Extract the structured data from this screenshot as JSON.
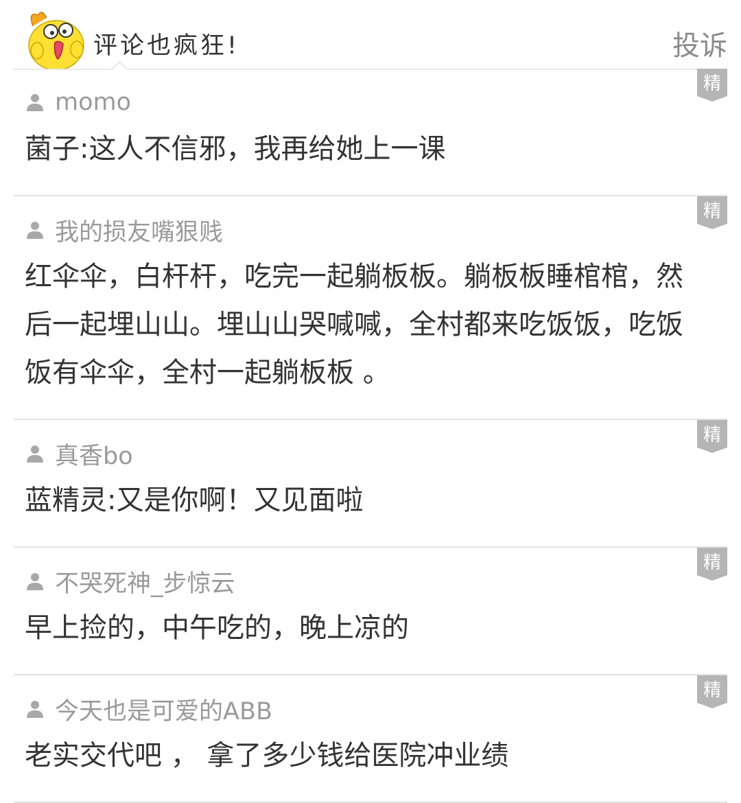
{
  "header": {
    "title": "评论也疯狂!",
    "report_label": "投诉"
  },
  "badge_label": "精",
  "comments": [
    {
      "user": "momo",
      "text": "菌子:这人不信邪，我再给她上一课"
    },
    {
      "user": "我的损友嘴狠贱",
      "text": "红伞伞，白杆杆，吃完一起躺板板。躺板板睡棺棺，然后一起埋山山。埋山山哭喊喊，全村都来吃饭饭，吃饭饭有伞伞，全村一起躺板板 。"
    },
    {
      "user": "真香bo",
      "text": "蓝精灵:又是你啊！又见面啦"
    },
    {
      "user": "不哭死神_步惊云",
      "text": "早上捡的，中午吃的，晚上凉的"
    },
    {
      "user": "今天也是可爱的ABB",
      "text": "老实交代吧 ， 拿了多少钱给医院冲业绩"
    }
  ],
  "colors": {
    "username": "#9a9a9a",
    "text": "#333333",
    "badge": "#b5b5b5",
    "divider": "#e2e2e2",
    "mascot": "#fde033"
  }
}
